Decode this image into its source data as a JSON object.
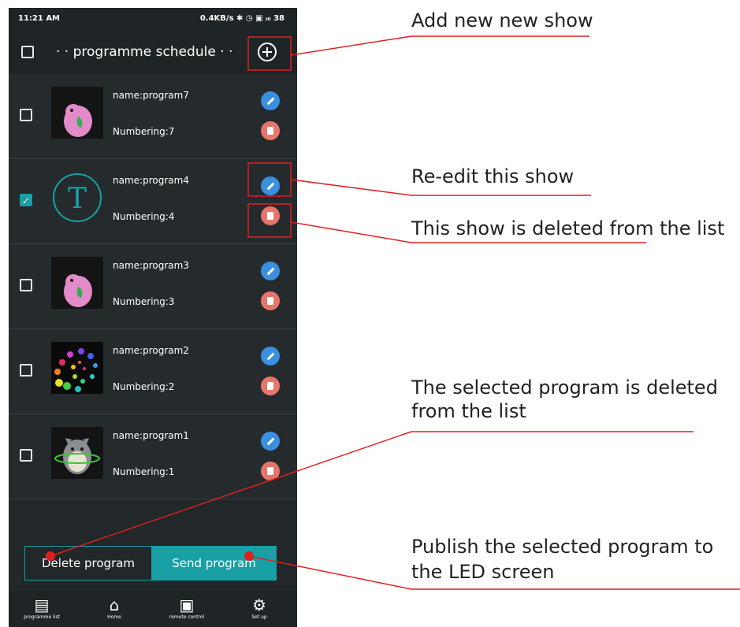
{
  "status_bar": {
    "time": "11:21 AM",
    "icons": "0.4KB/s ✱ ◷ ▣ ᵢₗₗ 38"
  },
  "header": {
    "title": "· · programme schedule · ·"
  },
  "programs": [
    {
      "name": "name:program7",
      "numbering": "Numbering:7",
      "checked": false
    },
    {
      "name": "name:program4",
      "numbering": "Numbering:4",
      "checked": true,
      "thumb_letter": "T"
    },
    {
      "name": "name:program3",
      "numbering": "Numbering:3",
      "checked": false
    },
    {
      "name": "name:program2",
      "numbering": "Numbering:2",
      "checked": false
    },
    {
      "name": "name:program1",
      "numbering": "Numbering:1",
      "checked": false
    }
  ],
  "actions": {
    "delete_label": "Delete program",
    "send_label": "Send program"
  },
  "bottom_nav": [
    {
      "label": "programme list",
      "icon": "list-icon"
    },
    {
      "label": "Home",
      "icon": "home-icon"
    },
    {
      "label": "remote control",
      "icon": "remote-icon"
    },
    {
      "label": "Set up",
      "icon": "gear-icon"
    }
  ],
  "annotations": {
    "add": "Add new new show",
    "edit": "Re-edit this show",
    "delete_one": "This show is deleted from the list",
    "delete_selected": [
      "The selected program is deleted",
      "from the list"
    ],
    "publish": [
      "Publish the selected program to",
      "the LED screen"
    ]
  },
  "colors": {
    "accent": "#18a0a5",
    "annotation_red": "#e02020",
    "background": "#22272a"
  }
}
